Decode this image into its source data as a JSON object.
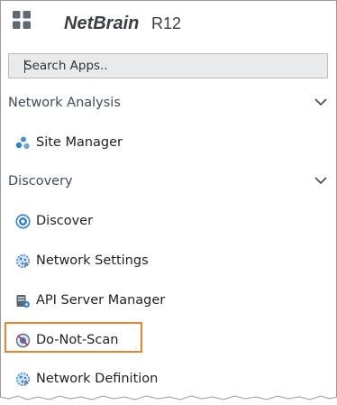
{
  "header": {
    "logo_text": "NetBrain",
    "logo_version": "R12"
  },
  "search": {
    "placeholder": "Search Apps.."
  },
  "sections": [
    {
      "title": "Network Analysis",
      "items": [
        {
          "label": "Site Manager",
          "icon": "site-manager-icon"
        }
      ]
    },
    {
      "title": "Discovery",
      "items": [
        {
          "label": "Discover",
          "icon": "discover-icon"
        },
        {
          "label": "Network Settings",
          "icon": "network-settings-icon"
        },
        {
          "label": "API Server Manager",
          "icon": "api-server-icon"
        },
        {
          "label": "Do-Not-Scan",
          "icon": "do-not-scan-icon"
        },
        {
          "label": "Network Definition",
          "icon": "network-definition-icon"
        }
      ]
    }
  ],
  "colors": {
    "highlight": "#e8842b",
    "section_text": "#3d4a5c",
    "search_bg": "#e9eaec",
    "icon_blue": "#2f7fd0"
  }
}
